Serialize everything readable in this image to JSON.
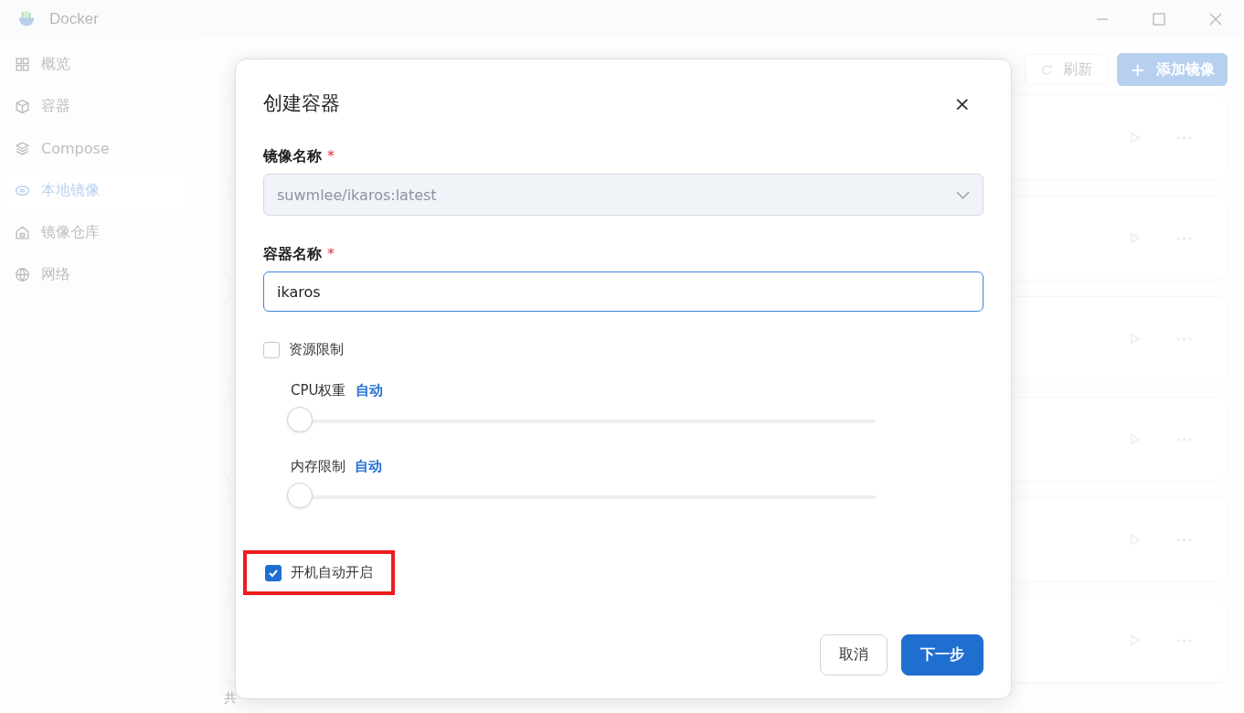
{
  "window": {
    "title": "Docker"
  },
  "sidebar": {
    "items": [
      {
        "label": "概览",
        "selected": false
      },
      {
        "label": "容器",
        "selected": false
      },
      {
        "label": "Compose",
        "selected": false
      },
      {
        "label": "本地镜像",
        "selected": true
      },
      {
        "label": "镜像仓库",
        "selected": false
      },
      {
        "label": "网络",
        "selected": false
      }
    ]
  },
  "main": {
    "refresh_button": "刷新",
    "add_button": {
      "icon": "+",
      "label": "添加镜像"
    },
    "rows": [
      {},
      {},
      {},
      {},
      {},
      {}
    ],
    "footer": "共"
  },
  "dialog": {
    "title": "创建容器",
    "close": "×",
    "image_name": {
      "label": "镜像名称",
      "required": "*",
      "value": "suwmlee/ikaros:latest",
      "disabled": true
    },
    "container_name": {
      "label": "容器名称",
      "required": "*",
      "value": "ikaros"
    },
    "resource_limit": {
      "label": "资源限制",
      "checked": false
    },
    "sliders": [
      {
        "label": "CPU权重",
        "value": "自动",
        "level": 0
      },
      {
        "label": "内存限制",
        "value": "自动",
        "level": 0
      }
    ],
    "autostart": {
      "label": "开机自动开启",
      "checked": true,
      "highlighted": true
    },
    "buttons": [
      {
        "label": "取消",
        "kind": "secondary"
      },
      {
        "label": "下一步",
        "kind": "primary"
      }
    ]
  }
}
